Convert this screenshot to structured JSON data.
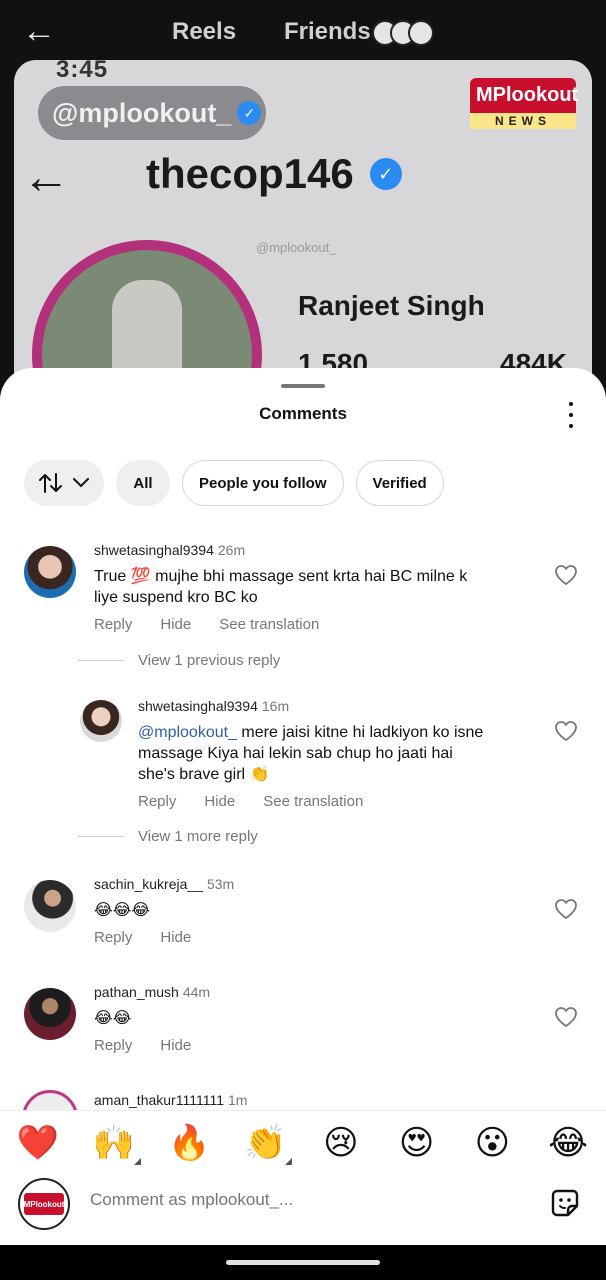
{
  "top_nav": {
    "tabs": [
      "Reels",
      "Friends"
    ]
  },
  "reel": {
    "status_ghost": "3:45",
    "mention_tag": "@mplookout_",
    "news_logo_top": "MPlookout",
    "news_logo_bottom": "NEWS",
    "profile_username": "thecop146",
    "watermark": "@mplookout_",
    "profile_name": "Ranjeet Singh",
    "stat_left": "1,580",
    "stat_right": "484K"
  },
  "sheet": {
    "title": "Comments",
    "filters": [
      "All",
      "People you follow",
      "Verified"
    ]
  },
  "comments": [
    {
      "username": "shwetasinghal9394",
      "time": "26m",
      "text_line1": "True 💯 mujhe bhi massage sent krta hai BC milne k",
      "text_line2": "liye suspend kro BC ko",
      "actions": [
        "Reply",
        "Hide",
        "See translation"
      ],
      "view_replies": "View 1 previous reply"
    },
    {
      "username": "shwetasinghal9394",
      "time": "16m",
      "mention": "@mplookout_",
      "text_line1": " mere jaisi kitne hi ladkiyon ko isne",
      "text_line2": "massage Kiya hai lekin sab chup ho jaati hai",
      "text_line3": "she's brave girl 👏",
      "actions": [
        "Reply",
        "Hide",
        "See translation"
      ],
      "view_replies": "View 1 more reply"
    },
    {
      "username": "sachin_kukreja__",
      "time": "53m",
      "text_line1": "😂😂😂",
      "actions": [
        "Reply",
        "Hide"
      ]
    },
    {
      "username": "pathan_mush",
      "time": "44m",
      "text_line1": "😂😂",
      "actions": [
        "Reply",
        "Hide"
      ]
    },
    {
      "username": "aman_thakur1111111",
      "time": "1m"
    }
  ],
  "emoji_bar": [
    "❤️",
    "🙌",
    "🔥",
    "👏",
    "😢",
    "😍",
    "😮",
    "😂"
  ],
  "input": {
    "placeholder": "Comment as mplookout_..."
  },
  "colors": {
    "mention": "#2e5ea8",
    "story_ring": "#b3317c",
    "brand_red": "#c8102e"
  }
}
